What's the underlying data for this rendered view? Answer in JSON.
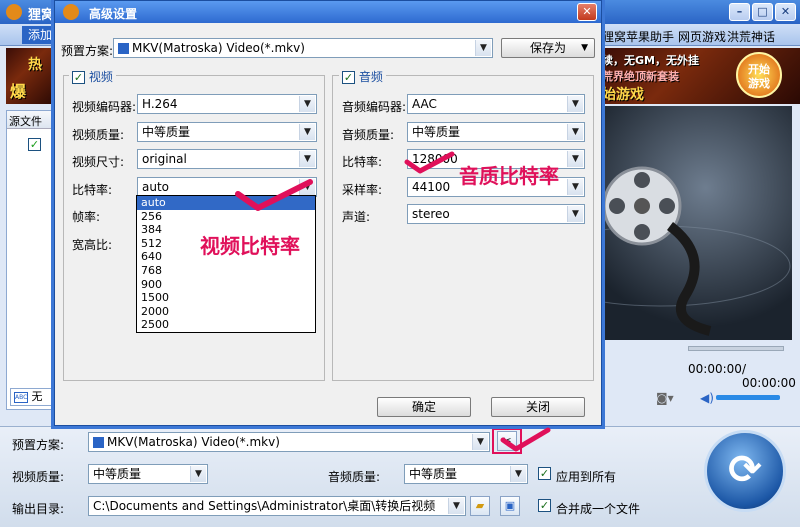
{
  "main": {
    "title": "狸窝",
    "add_file": "添加",
    "links": [
      "狸窝苹果助手",
      "网页游戏",
      "洪荒神话"
    ],
    "banner_texts": [
      "续，无GM，无外挂",
      "荒界绝顶新套装",
      "始游戏"
    ],
    "banner_left": [
      "热",
      "爆"
    ],
    "start_game": "开始\n游戏",
    "file_list_header": "源文件",
    "subtitle_value": "无",
    "subtitle_icon": "ABC",
    "time_current": "00:00:00",
    "time_total": "/ 00:00:00",
    "bottom": {
      "preset_label": "预置方案:",
      "preset_value": "MKV(Matroska) Video(*.mkv)",
      "video_quality_label": "视频质量:",
      "video_quality_value": "中等质量",
      "audio_quality_label": "音频质量:",
      "audio_quality_value": "中等质量",
      "apply_all_label": "应用到所有",
      "output_label": "输出目录:",
      "output_value": "C:\\Documents and Settings\\Administrator\\桌面\\转换后视频",
      "merge_label": "合并成一个文件"
    }
  },
  "dialog": {
    "title": "高级设置",
    "preset_label": "预置方案:",
    "preset_value": "MKV(Matroska) Video(*.mkv)",
    "save_as": "保存为",
    "video": {
      "title": "视频",
      "codec_label": "视频编码器:",
      "codec_value": "H.264",
      "quality_label": "视频质量:",
      "quality_value": "中等质量",
      "size_label": "视频尺寸:",
      "size_value": "original",
      "bitrate_label": "比特率:",
      "bitrate_value": "auto",
      "framerate_label": "帧率:",
      "aspect_label": "宽高比:",
      "bitrate_options": [
        "auto",
        "256",
        "384",
        "512",
        "640",
        "768",
        "900",
        "1500",
        "2000",
        "2500"
      ]
    },
    "audio": {
      "title": "音频",
      "codec_label": "音频编码器:",
      "codec_value": "AAC",
      "quality_label": "音频质量:",
      "quality_value": "中等质量",
      "bitrate_label": "比特率:",
      "bitrate_value": "128000",
      "samplerate_label": "采样率:",
      "samplerate_value": "44100",
      "channel_label": "声道:",
      "channel_value": "stereo"
    },
    "ok": "确定",
    "close": "关闭"
  },
  "annotations": {
    "video_bitrate": "视频比特率",
    "audio_bitrate": "音质比特率"
  },
  "colors": {
    "accent": "#2e6ad0",
    "annotation": "#e0105a",
    "selection": "#3169c6"
  }
}
